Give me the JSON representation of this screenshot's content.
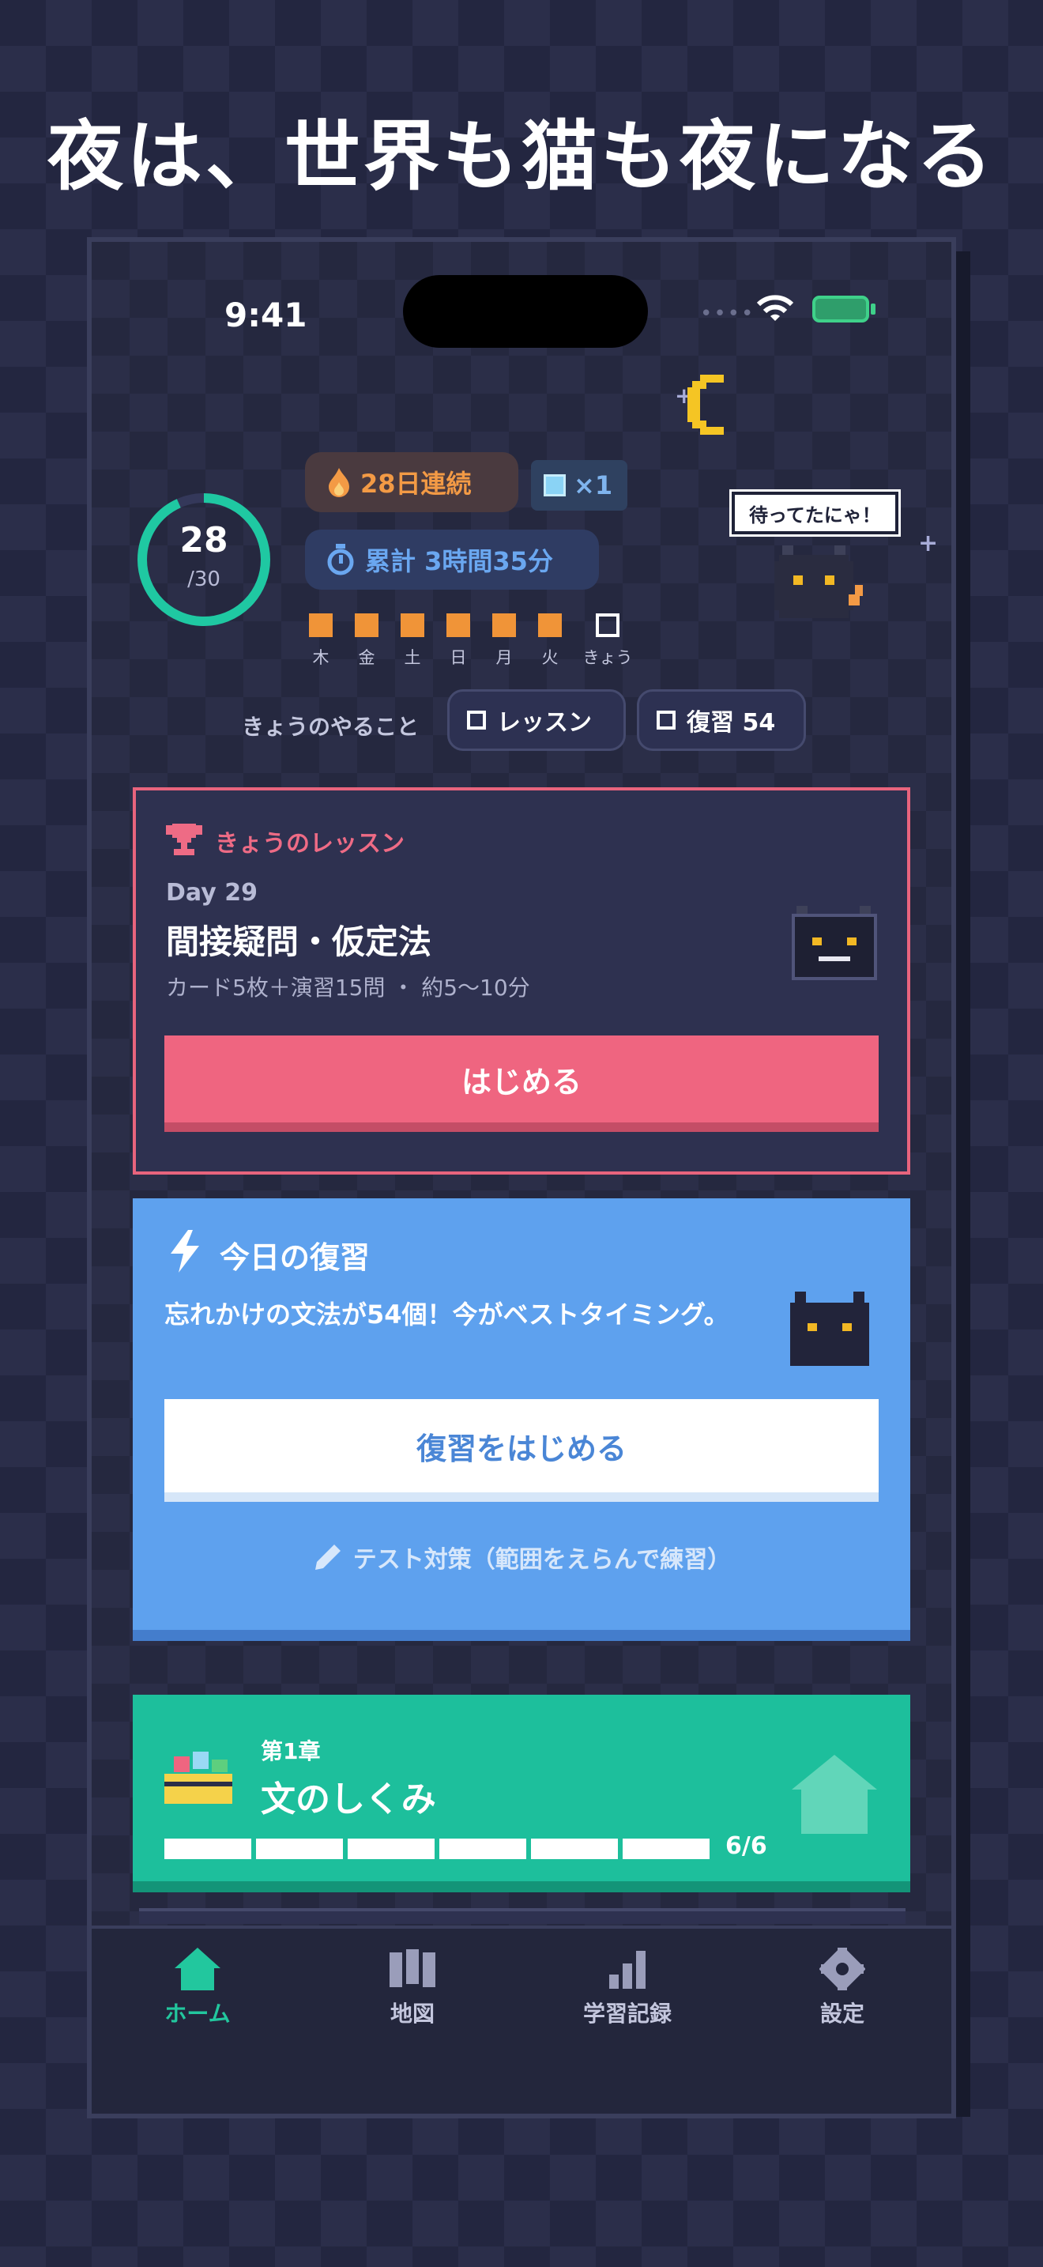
{
  "headline": "夜は、世界も猫も夜になる",
  "status": {
    "time": "9:41",
    "dots": "••••"
  },
  "progress_ring": {
    "value": "28",
    "total": "/30",
    "fraction": 0.933
  },
  "stats": {
    "streak": "28日連続",
    "gems": "×1",
    "total_time": "累計 3時間35分"
  },
  "week": [
    {
      "label": "木",
      "done": true
    },
    {
      "label": "金",
      "done": true
    },
    {
      "label": "土",
      "done": true
    },
    {
      "label": "日",
      "done": true
    },
    {
      "label": "月",
      "done": true
    },
    {
      "label": "火",
      "done": true
    },
    {
      "label": "きょう",
      "done": false
    }
  ],
  "cat_bubble": "待ってたにゃ！",
  "todo": {
    "label": "きょうのやること",
    "lesson_chip": "レッスン",
    "review_chip": "復習 54"
  },
  "lesson_card": {
    "tag": "きょうのレッスン",
    "day": "Day 29",
    "title": "間接疑問・仮定法",
    "meta": "カード5枚＋演習15問 ・ 約5〜10分",
    "button": "はじめる"
  },
  "review_card": {
    "title": "今日の復習",
    "body": "忘れかけの文法が54個！今がベストタイミング。",
    "button": "復習をはじめる",
    "test_link": "テスト対策（範囲をえらんで練習）"
  },
  "chapter_card": {
    "number": "第1章",
    "title": "文のしくみ",
    "segments": 6,
    "progress": "6/6"
  },
  "tabs": [
    {
      "label": "ホーム",
      "icon": "home-icon",
      "active": true
    },
    {
      "label": "地図",
      "icon": "map-icon",
      "active": false
    },
    {
      "label": "学習記録",
      "icon": "stats-icon",
      "active": false
    },
    {
      "label": "設定",
      "icon": "gear-icon",
      "active": false
    }
  ],
  "colors": {
    "accent_pink": "#ef6580",
    "accent_blue": "#5ea1ee",
    "accent_green": "#1dbf9c",
    "streak_orange": "#f39a45",
    "ring_teal": "#1fc8a2"
  }
}
